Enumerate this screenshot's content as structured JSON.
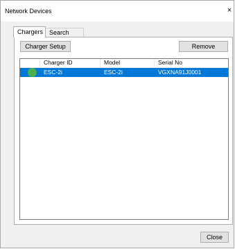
{
  "window": {
    "title": "Network Devices",
    "close_glyph": "×"
  },
  "tabs": [
    {
      "label": "Chargers",
      "active": true
    },
    {
      "label": "Search",
      "active": false
    }
  ],
  "toolbar": {
    "charger_setup_label": "Charger Setup",
    "remove_label": "Remove"
  },
  "table": {
    "columns": [
      "",
      "Charger ID",
      "Model",
      "Serial No"
    ],
    "rows": [
      {
        "status": "green-dot-icon",
        "charger_id": "ESC-2i",
        "model": "ESC-2i",
        "serial_no": "VGXNA91J0001",
        "selected": true
      }
    ]
  },
  "footer": {
    "close_label": "Close"
  },
  "colors": {
    "selection": "#0078d7",
    "status_ok": "#4caf50"
  }
}
